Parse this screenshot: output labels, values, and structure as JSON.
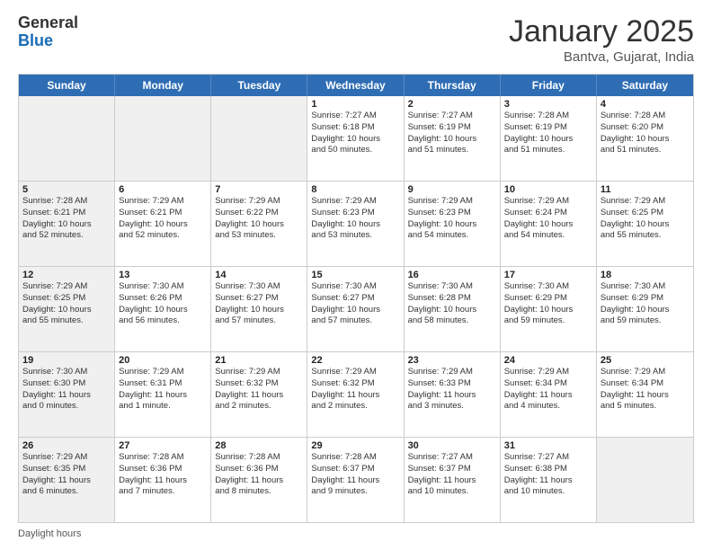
{
  "logo": {
    "general": "General",
    "blue": "Blue"
  },
  "header": {
    "month": "January 2025",
    "location": "Bantva, Gujarat, India"
  },
  "weekdays": [
    "Sunday",
    "Monday",
    "Tuesday",
    "Wednesday",
    "Thursday",
    "Friday",
    "Saturday"
  ],
  "footer": {
    "note": "Daylight hours"
  },
  "rows": [
    [
      {
        "day": "",
        "lines": [],
        "shaded": true
      },
      {
        "day": "",
        "lines": [],
        "shaded": true
      },
      {
        "day": "",
        "lines": [],
        "shaded": true
      },
      {
        "day": "1",
        "lines": [
          "Sunrise: 7:27 AM",
          "Sunset: 6:18 PM",
          "Daylight: 10 hours",
          "and 50 minutes."
        ],
        "shaded": false
      },
      {
        "day": "2",
        "lines": [
          "Sunrise: 7:27 AM",
          "Sunset: 6:19 PM",
          "Daylight: 10 hours",
          "and 51 minutes."
        ],
        "shaded": false
      },
      {
        "day": "3",
        "lines": [
          "Sunrise: 7:28 AM",
          "Sunset: 6:19 PM",
          "Daylight: 10 hours",
          "and 51 minutes."
        ],
        "shaded": false
      },
      {
        "day": "4",
        "lines": [
          "Sunrise: 7:28 AM",
          "Sunset: 6:20 PM",
          "Daylight: 10 hours",
          "and 51 minutes."
        ],
        "shaded": false
      }
    ],
    [
      {
        "day": "5",
        "lines": [
          "Sunrise: 7:28 AM",
          "Sunset: 6:21 PM",
          "Daylight: 10 hours",
          "and 52 minutes."
        ],
        "shaded": true
      },
      {
        "day": "6",
        "lines": [
          "Sunrise: 7:29 AM",
          "Sunset: 6:21 PM",
          "Daylight: 10 hours",
          "and 52 minutes."
        ],
        "shaded": false
      },
      {
        "day": "7",
        "lines": [
          "Sunrise: 7:29 AM",
          "Sunset: 6:22 PM",
          "Daylight: 10 hours",
          "and 53 minutes."
        ],
        "shaded": false
      },
      {
        "day": "8",
        "lines": [
          "Sunrise: 7:29 AM",
          "Sunset: 6:23 PM",
          "Daylight: 10 hours",
          "and 53 minutes."
        ],
        "shaded": false
      },
      {
        "day": "9",
        "lines": [
          "Sunrise: 7:29 AM",
          "Sunset: 6:23 PM",
          "Daylight: 10 hours",
          "and 54 minutes."
        ],
        "shaded": false
      },
      {
        "day": "10",
        "lines": [
          "Sunrise: 7:29 AM",
          "Sunset: 6:24 PM",
          "Daylight: 10 hours",
          "and 54 minutes."
        ],
        "shaded": false
      },
      {
        "day": "11",
        "lines": [
          "Sunrise: 7:29 AM",
          "Sunset: 6:25 PM",
          "Daylight: 10 hours",
          "and 55 minutes."
        ],
        "shaded": false
      }
    ],
    [
      {
        "day": "12",
        "lines": [
          "Sunrise: 7:29 AM",
          "Sunset: 6:25 PM",
          "Daylight: 10 hours",
          "and 55 minutes."
        ],
        "shaded": true
      },
      {
        "day": "13",
        "lines": [
          "Sunrise: 7:30 AM",
          "Sunset: 6:26 PM",
          "Daylight: 10 hours",
          "and 56 minutes."
        ],
        "shaded": false
      },
      {
        "day": "14",
        "lines": [
          "Sunrise: 7:30 AM",
          "Sunset: 6:27 PM",
          "Daylight: 10 hours",
          "and 57 minutes."
        ],
        "shaded": false
      },
      {
        "day": "15",
        "lines": [
          "Sunrise: 7:30 AM",
          "Sunset: 6:27 PM",
          "Daylight: 10 hours",
          "and 57 minutes."
        ],
        "shaded": false
      },
      {
        "day": "16",
        "lines": [
          "Sunrise: 7:30 AM",
          "Sunset: 6:28 PM",
          "Daylight: 10 hours",
          "and 58 minutes."
        ],
        "shaded": false
      },
      {
        "day": "17",
        "lines": [
          "Sunrise: 7:30 AM",
          "Sunset: 6:29 PM",
          "Daylight: 10 hours",
          "and 59 minutes."
        ],
        "shaded": false
      },
      {
        "day": "18",
        "lines": [
          "Sunrise: 7:30 AM",
          "Sunset: 6:29 PM",
          "Daylight: 10 hours",
          "and 59 minutes."
        ],
        "shaded": false
      }
    ],
    [
      {
        "day": "19",
        "lines": [
          "Sunrise: 7:30 AM",
          "Sunset: 6:30 PM",
          "Daylight: 11 hours",
          "and 0 minutes."
        ],
        "shaded": true
      },
      {
        "day": "20",
        "lines": [
          "Sunrise: 7:29 AM",
          "Sunset: 6:31 PM",
          "Daylight: 11 hours",
          "and 1 minute."
        ],
        "shaded": false
      },
      {
        "day": "21",
        "lines": [
          "Sunrise: 7:29 AM",
          "Sunset: 6:32 PM",
          "Daylight: 11 hours",
          "and 2 minutes."
        ],
        "shaded": false
      },
      {
        "day": "22",
        "lines": [
          "Sunrise: 7:29 AM",
          "Sunset: 6:32 PM",
          "Daylight: 11 hours",
          "and 2 minutes."
        ],
        "shaded": false
      },
      {
        "day": "23",
        "lines": [
          "Sunrise: 7:29 AM",
          "Sunset: 6:33 PM",
          "Daylight: 11 hours",
          "and 3 minutes."
        ],
        "shaded": false
      },
      {
        "day": "24",
        "lines": [
          "Sunrise: 7:29 AM",
          "Sunset: 6:34 PM",
          "Daylight: 11 hours",
          "and 4 minutes."
        ],
        "shaded": false
      },
      {
        "day": "25",
        "lines": [
          "Sunrise: 7:29 AM",
          "Sunset: 6:34 PM",
          "Daylight: 11 hours",
          "and 5 minutes."
        ],
        "shaded": false
      }
    ],
    [
      {
        "day": "26",
        "lines": [
          "Sunrise: 7:29 AM",
          "Sunset: 6:35 PM",
          "Daylight: 11 hours",
          "and 6 minutes."
        ],
        "shaded": true
      },
      {
        "day": "27",
        "lines": [
          "Sunrise: 7:28 AM",
          "Sunset: 6:36 PM",
          "Daylight: 11 hours",
          "and 7 minutes."
        ],
        "shaded": false
      },
      {
        "day": "28",
        "lines": [
          "Sunrise: 7:28 AM",
          "Sunset: 6:36 PM",
          "Daylight: 11 hours",
          "and 8 minutes."
        ],
        "shaded": false
      },
      {
        "day": "29",
        "lines": [
          "Sunrise: 7:28 AM",
          "Sunset: 6:37 PM",
          "Daylight: 11 hours",
          "and 9 minutes."
        ],
        "shaded": false
      },
      {
        "day": "30",
        "lines": [
          "Sunrise: 7:27 AM",
          "Sunset: 6:37 PM",
          "Daylight: 11 hours",
          "and 10 minutes."
        ],
        "shaded": false
      },
      {
        "day": "31",
        "lines": [
          "Sunrise: 7:27 AM",
          "Sunset: 6:38 PM",
          "Daylight: 11 hours",
          "and 10 minutes."
        ],
        "shaded": false
      },
      {
        "day": "",
        "lines": [],
        "shaded": true
      }
    ]
  ]
}
